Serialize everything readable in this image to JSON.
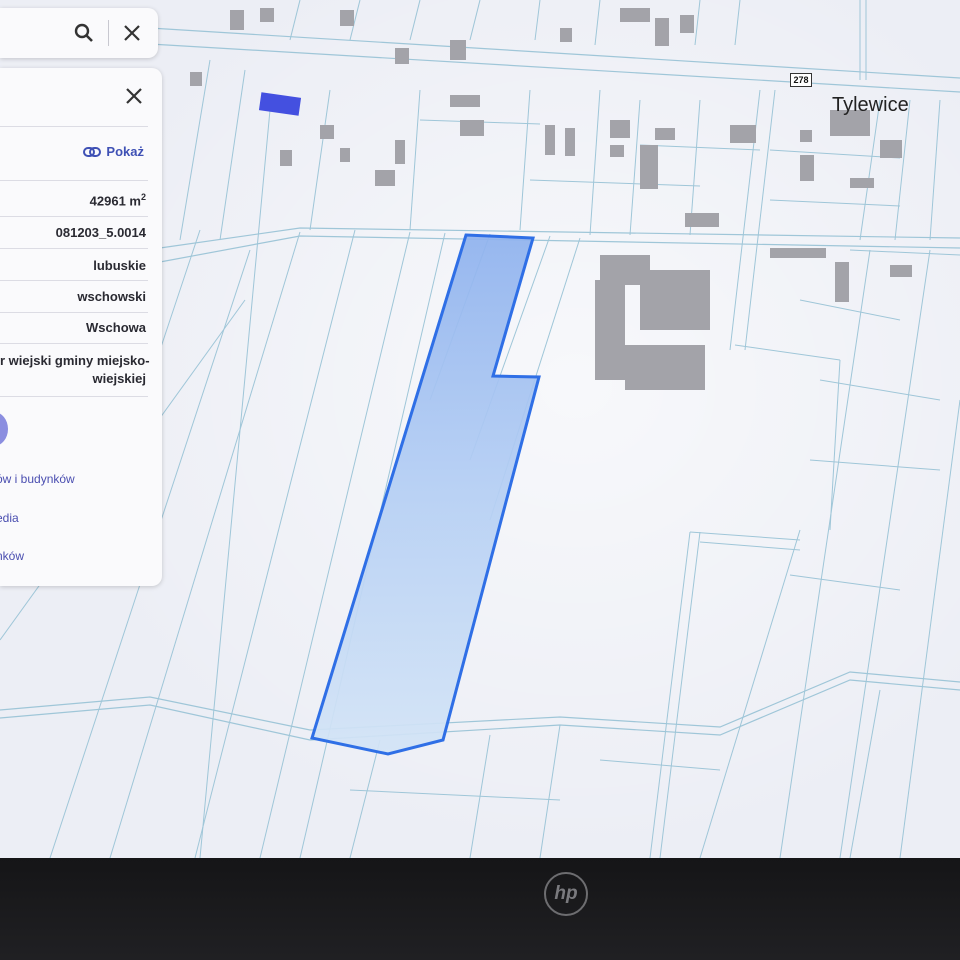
{
  "map": {
    "place_label": "Tylewice",
    "road_number": "278"
  },
  "search": {
    "search_icon": "search-icon",
    "close_icon": "close-icon"
  },
  "panel": {
    "close_icon": "close-icon",
    "show_label": "Pokaż",
    "area_value": "42961 m",
    "area_unit_sup": "2",
    "parcel_id": "081203_5.0014",
    "voivodeship": "lubuskie",
    "county": "wschowski",
    "municipality": "Wschowa",
    "municipality_type_line1": "r wiejski gminy miejsko-",
    "municipality_type_line2": "wiejskiej",
    "links": [
      "ów i budynków",
      "edia",
      "nków"
    ]
  },
  "colors": {
    "parcel_fill": "#a9c6f2",
    "parcel_stroke": "#2f6fe6",
    "parcel_lines": "#8fc3dc",
    "buildings": "#a0a0a6",
    "link": "#4a4eb0"
  }
}
